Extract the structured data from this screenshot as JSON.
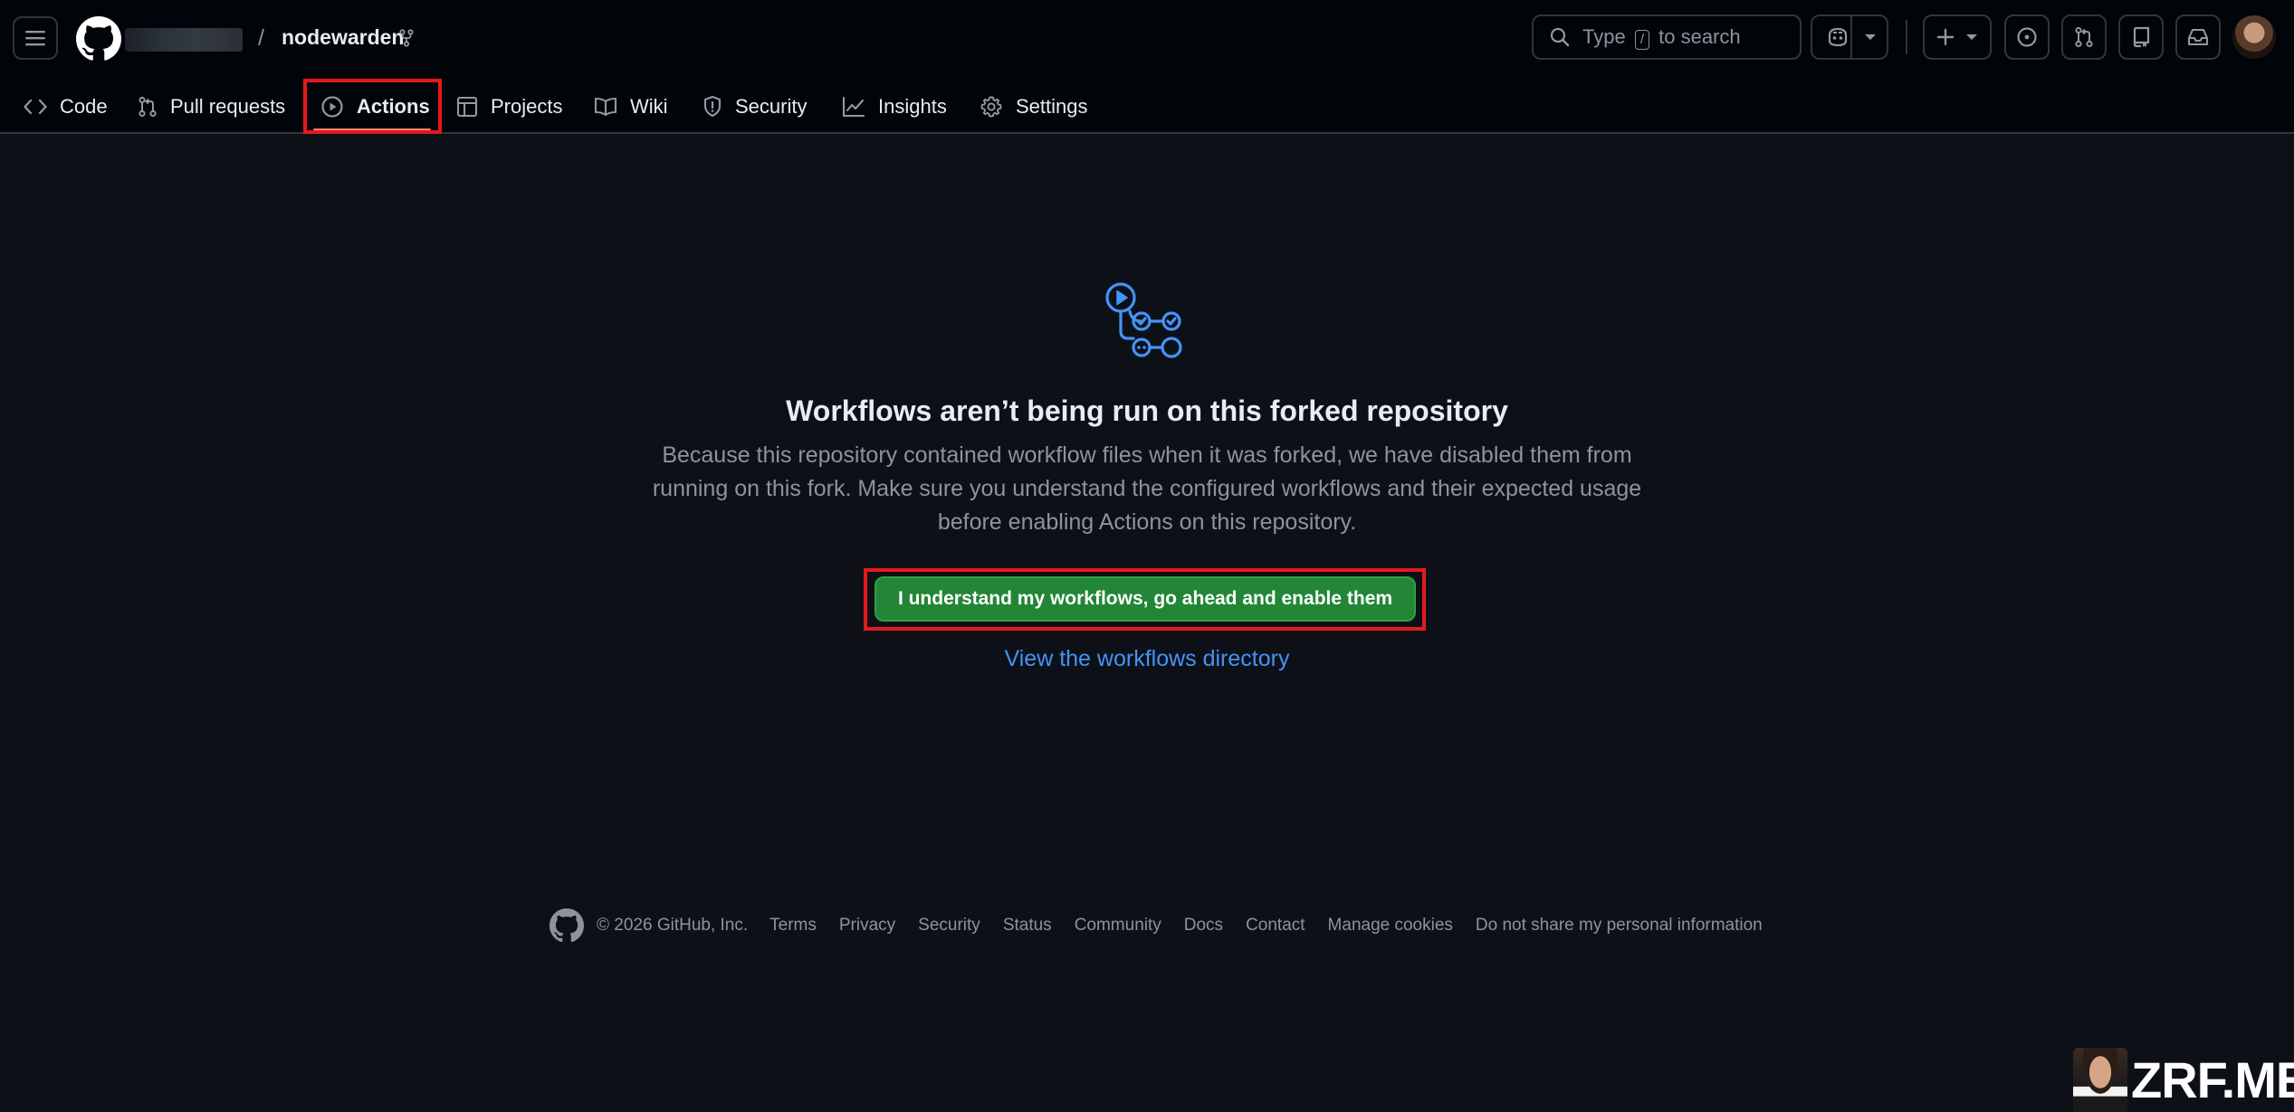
{
  "header": {
    "repo_separator": "/",
    "repo_name": "nodewarden",
    "search": {
      "prefix": "Type",
      "key": "/",
      "suffix": "to search"
    }
  },
  "tabs": [
    {
      "label": "Code",
      "icon": "code-icon"
    },
    {
      "label": "Pull requests",
      "icon": "git-pull-request-icon"
    },
    {
      "label": "Actions",
      "icon": "play-icon",
      "active": true
    },
    {
      "label": "Projects",
      "icon": "table-icon"
    },
    {
      "label": "Wiki",
      "icon": "book-icon"
    },
    {
      "label": "Security",
      "icon": "shield-icon"
    },
    {
      "label": "Insights",
      "icon": "graph-icon"
    },
    {
      "label": "Settings",
      "icon": "gear-icon"
    }
  ],
  "main": {
    "headline": "Workflows aren’t being run on this forked repository",
    "description": "Because this repository contained workflow files when it was forked, we have disabled them from running on this fork. Make sure you understand the configured workflows and their expected usage before enabling Actions on this repository.",
    "enable_button": "I understand my workflows, go ahead and enable them",
    "workflows_link": "View the workflows directory"
  },
  "footer": {
    "copyright": "© 2026 GitHub, Inc.",
    "links": [
      "Terms",
      "Privacy",
      "Security",
      "Status",
      "Community",
      "Docs",
      "Contact",
      "Manage cookies",
      "Do not share my personal information"
    ]
  },
  "watermark": "ZRF.ME",
  "colors": {
    "background": "#0d1117",
    "header": "#010409",
    "border": "#30363d",
    "primary_button": "#238636",
    "link": "#4493f8",
    "highlight": "#e5191e",
    "muted_text": "#8b949e"
  }
}
